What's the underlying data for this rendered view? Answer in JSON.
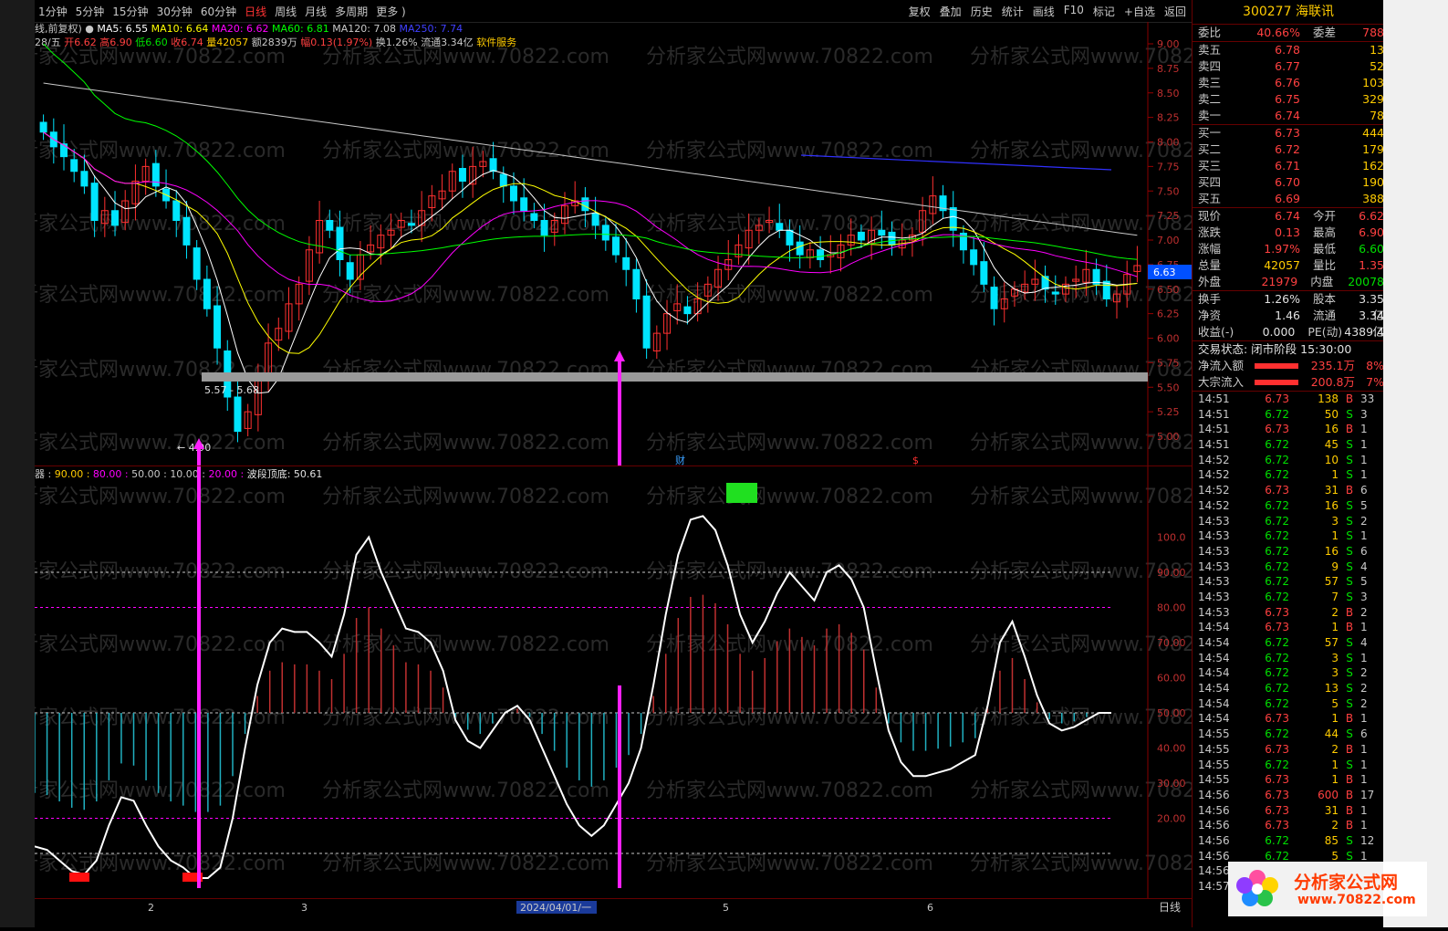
{
  "toolbar": {
    "periods": [
      "1分钟",
      "5分钟",
      "15分钟",
      "30分钟",
      "60分钟",
      "日线",
      "周线",
      "月线",
      "多周期",
      "更多 )"
    ],
    "active_period": "日线",
    "right": [
      "复权",
      "叠加",
      "历史",
      "统计",
      "画线",
      "F10",
      "标记",
      "+自选",
      "返回"
    ]
  },
  "header": {
    "mode": "线,前复权)",
    "ma": [
      {
        "label": "MA5: 6.55",
        "color": "#ffffff"
      },
      {
        "label": "MA10: 6.64",
        "color": "#ffff00"
      },
      {
        "label": "MA20: 6.62",
        "color": "#ff00ff"
      },
      {
        "label": "MA60: 6.81",
        "color": "#00ff00"
      },
      {
        "label": "MA120: 7.08",
        "color": "#c8c8c8"
      },
      {
        "label": "MA250: 7.74",
        "color": "#4040ff"
      }
    ],
    "info": [
      {
        "text": "28/五",
        "color": "#c8c8c8"
      },
      {
        "text": "开6.62",
        "color": "#ff4040"
      },
      {
        "text": "高6.90",
        "color": "#ff4040"
      },
      {
        "text": "低6.60",
        "color": "#00e000"
      },
      {
        "text": "收6.74",
        "color": "#ff4040"
      },
      {
        "text": "量42057",
        "color": "#ffcc00"
      },
      {
        "text": "额2839万",
        "color": "#c8c8c8"
      },
      {
        "text": "幅0.13(1.97%)",
        "color": "#ff4040"
      },
      {
        "text": "换1.26%",
        "color": "#c8c8c8"
      },
      {
        "text": "流通3.34亿",
        "color": "#c8c8c8"
      },
      {
        "text": "软件服务",
        "color": "#ffcc00"
      }
    ]
  },
  "watermark": "分析家公式网www.70822.com",
  "main_axis": [
    "9.00",
    "8.75",
    "8.50",
    "8.25",
    "8.00",
    "7.75",
    "7.50",
    "7.25",
    "7.00",
    "6.75",
    "6.50",
    "6.25",
    "6.00",
    "5.75",
    "5.50",
    "5.25",
    "5.00"
  ],
  "price_tag": "6.63",
  "band_label": "5.57 - 5.68",
  "low_label": "4.90",
  "markers": {
    "cai": "财",
    "s": "$"
  },
  "indicator": {
    "header_prefix": "器",
    "levels": [
      {
        "text": "90.00",
        "color": "#ffcc00"
      },
      {
        "text": "80.00",
        "color": "#ff00ff"
      },
      {
        "text": "50.00",
        "color": "#c8c8c8"
      },
      {
        "text": "10.00",
        "color": "#c8c8c8"
      },
      {
        "text": "20.00",
        "color": "#ff00ff"
      }
    ],
    "extra": "波段顶底: 50.61",
    "axis": [
      "100.0",
      "90.00",
      "80.00",
      "70.00",
      "60.00",
      "50.00",
      "40.00",
      "30.00",
      "20.00"
    ]
  },
  "xaxis": {
    "labels": [
      "2",
      "3",
      "2024/04/01/一",
      "5",
      "6"
    ],
    "period": "日线"
  },
  "quote": {
    "title": "300277 海联讯",
    "webi": {
      "label": "委比",
      "value": "40.66%",
      "label2": "委差",
      "value2": "788"
    },
    "asks": [
      {
        "label": "卖五",
        "price": "6.78",
        "vol": "13"
      },
      {
        "label": "卖四",
        "price": "6.77",
        "vol": "52"
      },
      {
        "label": "卖三",
        "price": "6.76",
        "vol": "103"
      },
      {
        "label": "卖二",
        "price": "6.75",
        "vol": "329"
      },
      {
        "label": "卖一",
        "price": "6.74",
        "vol": "78"
      }
    ],
    "bids": [
      {
        "label": "买一",
        "price": "6.73",
        "vol": "444"
      },
      {
        "label": "买二",
        "price": "6.72",
        "vol": "179"
      },
      {
        "label": "买三",
        "price": "6.71",
        "vol": "162"
      },
      {
        "label": "买四",
        "price": "6.70",
        "vol": "190"
      },
      {
        "label": "买五",
        "price": "6.69",
        "vol": "388"
      }
    ],
    "stats": [
      {
        "l1": "现价",
        "v1": "6.74",
        "c1": "red",
        "l2": "今开",
        "v2": "6.62",
        "c2": "red"
      },
      {
        "l1": "涨跌",
        "v1": "0.13",
        "c1": "red",
        "l2": "最高",
        "v2": "6.90",
        "c2": "red"
      },
      {
        "l1": "涨幅",
        "v1": "1.97%",
        "c1": "red",
        "l2": "最低",
        "v2": "6.60",
        "c2": "grn"
      },
      {
        "l1": "总量",
        "v1": "42057",
        "c1": "yel",
        "l2": "量比",
        "v2": "1.35",
        "c2": "red"
      },
      {
        "l1": "外盘",
        "v1": "21979",
        "c1": "red",
        "l2": "内盘",
        "v2": "20078",
        "c2": "grn"
      }
    ],
    "stats2": [
      {
        "l1": "换手",
        "v1": "1.26%",
        "l2": "股本",
        "v2": "3.35亿"
      },
      {
        "l1": "净资",
        "v1": "1.46",
        "l2": "流通",
        "v2": "3.34亿"
      },
      {
        "l1": "收益(-)",
        "v1": "0.000",
        "l2": "PE(动)",
        "v2": "4389.4"
      }
    ],
    "status": "交易状态: 闭市阶段 15:30:00",
    "flows": [
      {
        "label": "净流入额",
        "value": "235.1万",
        "pct": "8%"
      },
      {
        "label": "大宗流入",
        "value": "200.8万",
        "pct": "7%"
      }
    ],
    "ticks": [
      [
        "14:51",
        "6.73",
        "138",
        "B",
        "33"
      ],
      [
        "14:51",
        "6.72",
        "50",
        "S",
        "3"
      ],
      [
        "14:51",
        "6.73",
        "16",
        "B",
        "1"
      ],
      [
        "14:51",
        "6.72",
        "45",
        "S",
        "1"
      ],
      [
        "14:52",
        "6.72",
        "10",
        "S",
        "1"
      ],
      [
        "14:52",
        "6.72",
        "1",
        "S",
        "1"
      ],
      [
        "14:52",
        "6.73",
        "31",
        "B",
        "6"
      ],
      [
        "14:52",
        "6.72",
        "16",
        "S",
        "5"
      ],
      [
        "14:53",
        "6.72",
        "3",
        "S",
        "2"
      ],
      [
        "14:53",
        "6.72",
        "1",
        "S",
        "1"
      ],
      [
        "14:53",
        "6.72",
        "16",
        "S",
        "6"
      ],
      [
        "14:53",
        "6.72",
        "9",
        "S",
        "4"
      ],
      [
        "14:53",
        "6.72",
        "57",
        "S",
        "5"
      ],
      [
        "14:53",
        "6.72",
        "7",
        "S",
        "3"
      ],
      [
        "14:53",
        "6.73",
        "2",
        "B",
        "2"
      ],
      [
        "14:54",
        "6.73",
        "1",
        "B",
        "1"
      ],
      [
        "14:54",
        "6.72",
        "57",
        "S",
        "4"
      ],
      [
        "14:54",
        "6.72",
        "3",
        "S",
        "1"
      ],
      [
        "14:54",
        "6.72",
        "3",
        "S",
        "2"
      ],
      [
        "14:54",
        "6.72",
        "13",
        "S",
        "2"
      ],
      [
        "14:54",
        "6.72",
        "5",
        "S",
        "2"
      ],
      [
        "14:54",
        "6.73",
        "1",
        "B",
        "1"
      ],
      [
        "14:55",
        "6.72",
        "44",
        "S",
        "6"
      ],
      [
        "14:55",
        "6.73",
        "2",
        "B",
        "1"
      ],
      [
        "14:55",
        "6.72",
        "1",
        "S",
        "1"
      ],
      [
        "14:55",
        "6.73",
        "1",
        "B",
        "1"
      ],
      [
        "14:56",
        "6.73",
        "600",
        "B",
        "17"
      ],
      [
        "14:56",
        "6.73",
        "31",
        "B",
        "1"
      ],
      [
        "14:56",
        "6.73",
        "2",
        "B",
        "1"
      ],
      [
        "14:56",
        "6.72",
        "85",
        "S",
        "12"
      ],
      [
        "14:56",
        "6.72",
        "5",
        "S",
        "1"
      ],
      [
        "14:56",
        "",
        "",
        "",
        ""
      ],
      [
        "14:57",
        "",
        "",
        "",
        ""
      ]
    ]
  },
  "logo": {
    "name": "分析家公式网",
    "url": "www.70822.com"
  }
}
